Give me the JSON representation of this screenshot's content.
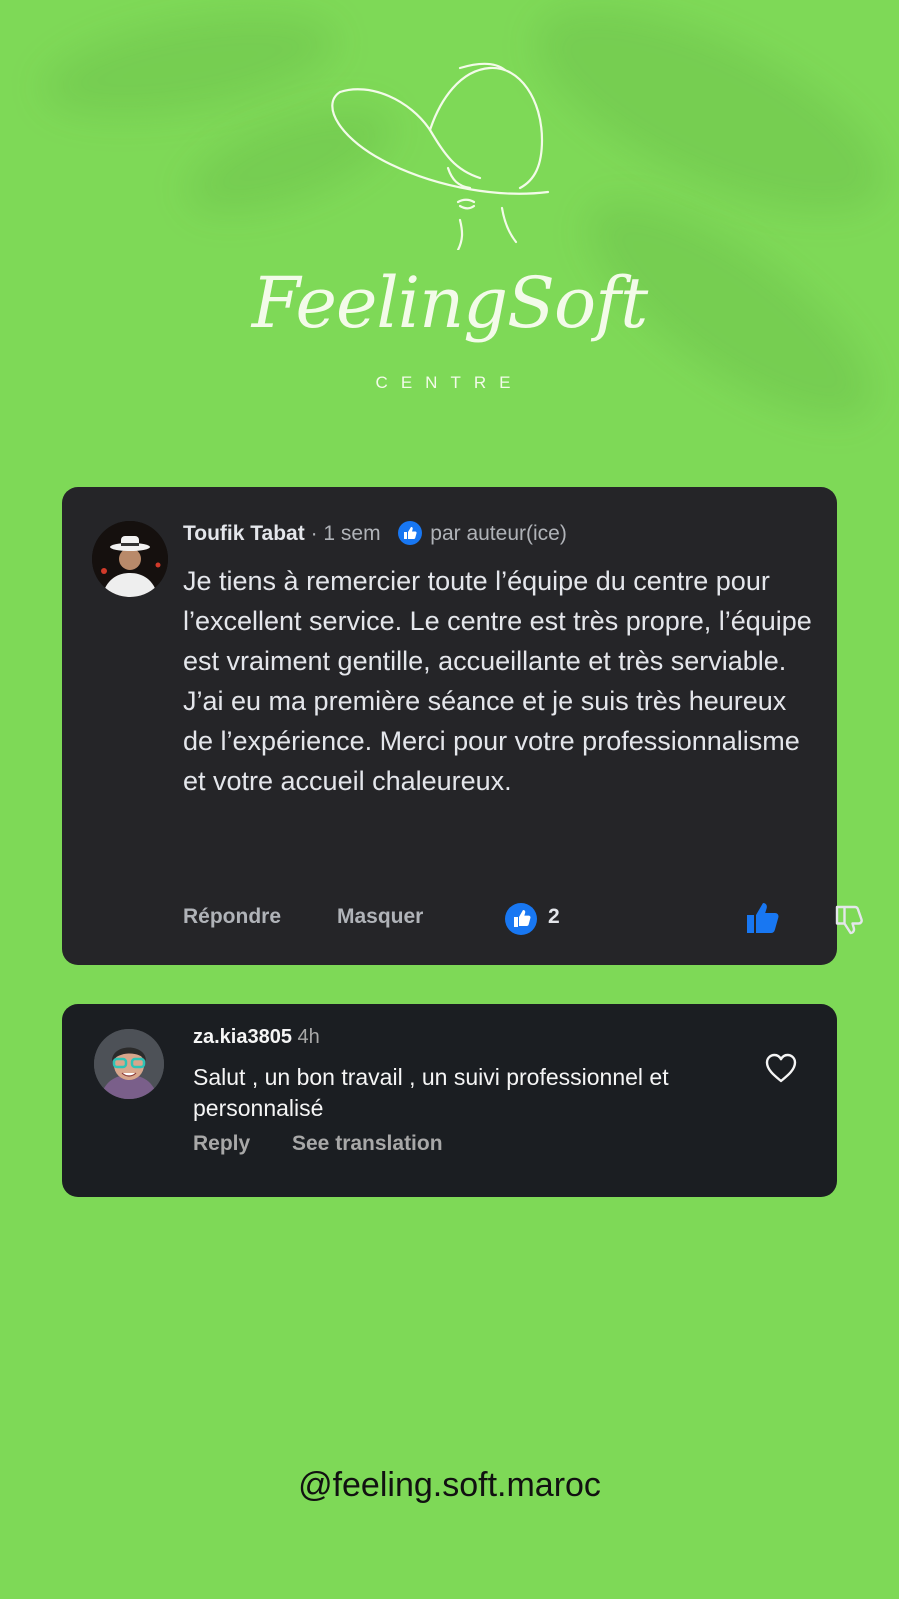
{
  "colors": {
    "background": "#7ed957",
    "card1": "#252528",
    "card2": "#1b1e22",
    "like_blue": "#1877f2"
  },
  "logo": {
    "brand": "FeelingSoft",
    "subtitle": "CENTRE",
    "icon": "woman-hat-icon"
  },
  "comment_fb": {
    "author": "Toufik Tabat",
    "time": "1 sem",
    "liked_by": "par auteur(ice)",
    "body": "Je tiens à remercier toute l’équipe du centre pour l’excellent service. Le centre est très propre, l’équipe est vraiment gentille, accueillante et très serviable. J’ai eu ma première séance  et je suis très heureux de l’expérience. Merci pour votre professionnalisme et votre accueil chaleureux.",
    "reply_label": "Répondre",
    "hide_label": "Masquer",
    "like_count": "2",
    "icons": [
      "like-badge-icon",
      "thumbs-up-icon",
      "thumbs-down-icon"
    ]
  },
  "comment_ig": {
    "author": "za.kia3805",
    "time": "4h",
    "body": "Salut , un bon travail , un suivi professionnel et personnalisé",
    "reply_label": "Reply",
    "translate_label": "See translation",
    "icons": [
      "heart-icon"
    ]
  },
  "footer": {
    "handle": "@feeling.soft.maroc"
  }
}
